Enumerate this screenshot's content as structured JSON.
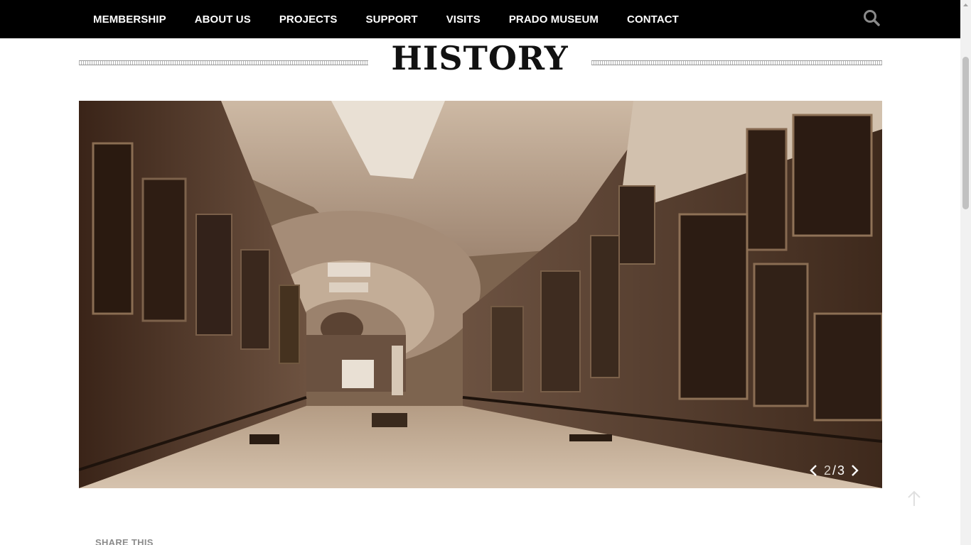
{
  "nav": {
    "items": [
      {
        "label": "MEMBERSHIP"
      },
      {
        "label": "ABOUT US"
      },
      {
        "label": "PROJECTS"
      },
      {
        "label": "SUPPORT"
      },
      {
        "label": "VISITS"
      },
      {
        "label": "PRADO MUSEUM"
      },
      {
        "label": "CONTACT"
      }
    ],
    "search_icon": "search-icon"
  },
  "page": {
    "title": "HISTORY"
  },
  "slider": {
    "image_description_icon": "gallery-photo",
    "current": "2",
    "separator": "/",
    "total": "3",
    "prev_icon": "chevron-left-icon",
    "next_icon": "chevron-right-icon"
  },
  "share": {
    "label": "SHARE THIS"
  },
  "colors": {
    "nav_background": "#000000",
    "nav_text": "#ffffff",
    "title": "#111111",
    "sepia": "#6b5440"
  }
}
